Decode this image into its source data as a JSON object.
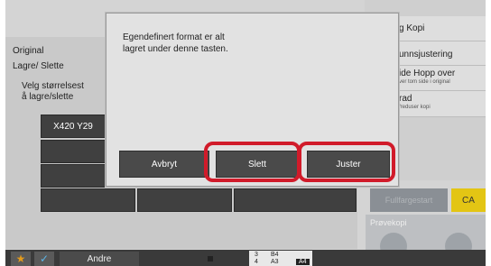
{
  "modal": {
    "message_line1": "Egendefinert format er alt",
    "message_line2": "lagret under denne tasten.",
    "buttons": {
      "cancel": "Avbryt",
      "delete": "Slett",
      "adjust": "Juster"
    },
    "highlight_color": "#d11b2a"
  },
  "background": {
    "title": "Original",
    "subtitle": "Lagre/ Slette",
    "instruction_line1": "Velg størrelsest",
    "instruction_line2": "å lagre/slette",
    "size_button": "X420 Y29"
  },
  "right_panel": {
    "items": [
      {
        "label": "g Kopi",
        "sub": ""
      },
      {
        "label": "unnsjustering",
        "sub": ""
      },
      {
        "label": "ide Hopp over",
        "sub": "ver tom side i original"
      },
      {
        "label": "rad",
        "sub": "/reduser kopi"
      }
    ],
    "sub_button": "Fullfargestart",
    "ca_button": "CA",
    "preview_label": "Prøvekopi"
  },
  "bottom_bar": {
    "other_button": "Andre",
    "tray_rows": [
      {
        "num": "3",
        "size": "B4"
      },
      {
        "num": "4",
        "size": "A3"
      }
    ],
    "tray_extra": "A4"
  },
  "colors": {
    "accent_yellow": "#e3c514",
    "star": "#e39b1c",
    "check": "#5db6e8"
  }
}
